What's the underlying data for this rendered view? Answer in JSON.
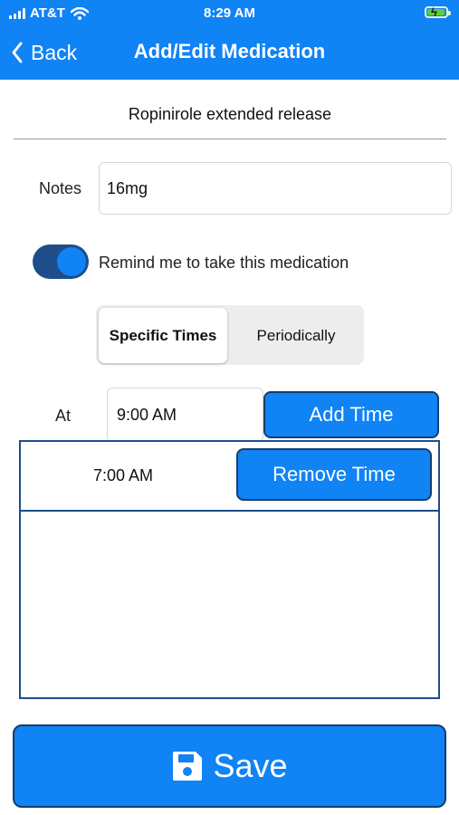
{
  "status_bar": {
    "carrier": "AT&T",
    "time": "8:29 AM",
    "battery_level": 0.9,
    "battery_charging": true
  },
  "header": {
    "back_label": "Back",
    "title": "Add/Edit Medication",
    "background_color": "#1083f5"
  },
  "medication": {
    "name": "Ropinirole extended release"
  },
  "notes": {
    "label": "Notes",
    "value": "16mg"
  },
  "reminder": {
    "enabled": true,
    "label": "Remind me to take this medication"
  },
  "schedule_mode": {
    "options": [
      "Specific Times",
      "Periodically"
    ],
    "selected": "Specific Times"
  },
  "time_entry": {
    "label": "At",
    "value": "9:00 AM",
    "add_button_label": "Add Time"
  },
  "times_list": [
    {
      "time": "7:00 AM",
      "remove_label": "Remove Time"
    }
  ],
  "save": {
    "label": "Save",
    "icon": "floppy-disk-icon"
  },
  "colors": {
    "accent": "#1083f5",
    "button_border": "#153d70",
    "toggle_track": "#1d4e89"
  }
}
